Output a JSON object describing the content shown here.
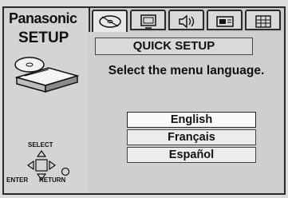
{
  "brand": "Panasonic",
  "menu_title": "SETUP",
  "tabs": [
    {
      "icon": "disc-icon"
    },
    {
      "icon": "monitor-icon"
    },
    {
      "icon": "speaker-icon"
    },
    {
      "icon": "display-settings-icon"
    },
    {
      "icon": "grid-icon"
    }
  ],
  "dialog": {
    "title": "QUICK SETUP",
    "prompt": "Select the menu language.",
    "options": [
      "English",
      "Français",
      "Español"
    ],
    "selected": "English"
  },
  "controls": {
    "select_label": "SELECT",
    "enter_label": "ENTER",
    "return_label": "RETURN"
  }
}
